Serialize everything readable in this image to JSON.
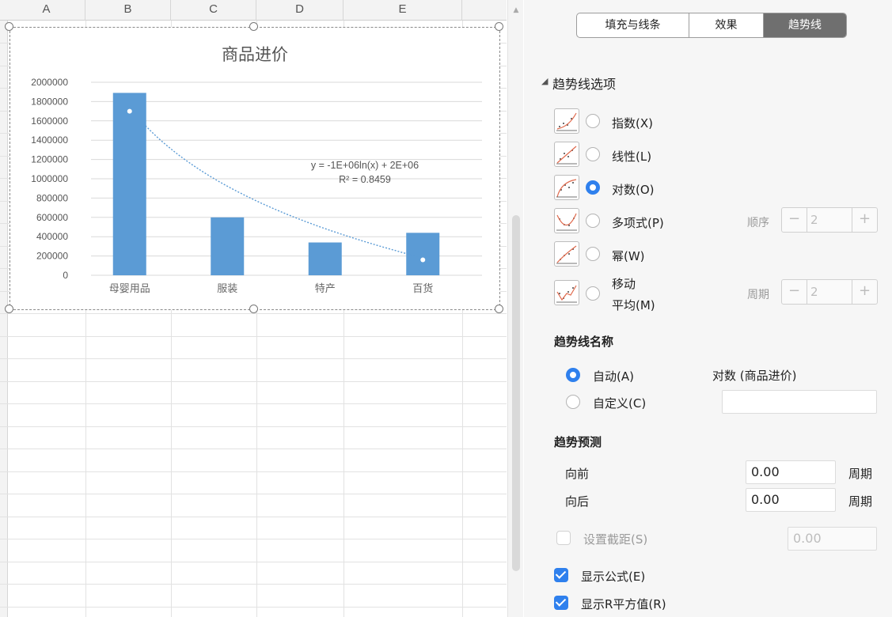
{
  "sheet": {
    "columns": [
      "A",
      "B",
      "C",
      "D",
      "E"
    ]
  },
  "chart_data": {
    "type": "bar",
    "title": "商品进价",
    "categories": [
      "母婴用品",
      "服装",
      "特产",
      "百货"
    ],
    "values": [
      1890000,
      600000,
      340000,
      440000
    ],
    "ylim": [
      0,
      2000000
    ],
    "yticks": [
      "2000000",
      "1800000",
      "1600000",
      "1400000",
      "1200000",
      "1000000",
      "800000",
      "600000",
      "400000",
      "200000",
      "0"
    ],
    "bar_color": "#5b9bd5",
    "grid": true,
    "trendline": {
      "type": "logarithmic",
      "equation": "y = -1E+06ln(x) + 2E+06",
      "r_squared": "R² = 0.8459",
      "start": 1550000,
      "end": 180000,
      "color": "#5b9bd5",
      "style": "dotted"
    },
    "markers": [
      1700000,
      160000
    ]
  },
  "panel": {
    "tabs": [
      {
        "label": "填充与线条",
        "active": false
      },
      {
        "label": "效果",
        "active": false
      },
      {
        "label": "趋势线",
        "active": true
      }
    ],
    "section_title": "趋势线选项",
    "types": {
      "exp": "指数(X)",
      "linear": "线性(L)",
      "log": "对数(O)",
      "poly": "多项式(P)",
      "power": "幂(W)",
      "moving_1": "移动",
      "moving_2": "平均(M)"
    },
    "selected_type": "对数(O)",
    "order_label": "顺序",
    "order_value": "2",
    "period_label": "周期",
    "period_value": "2",
    "name_title": "趋势线名称",
    "auto_label": "自动(A)",
    "auto_value": "对数 (商品进价)",
    "custom_label": "自定义(C)",
    "forecast_title": "趋势预测",
    "forward_label": "向前",
    "forward_value": "0.00",
    "backward_label": "向后",
    "backward_value": "0.00",
    "unit_label": "周期",
    "intercept_label": "设置截距(S)",
    "intercept_value": "0.00",
    "show_equation_label": "显示公式(E)",
    "show_r2_label": "显示R平方值(R)"
  },
  "colors": {
    "accent": "#2f80ed",
    "tab_active": "#6f6f6f"
  }
}
